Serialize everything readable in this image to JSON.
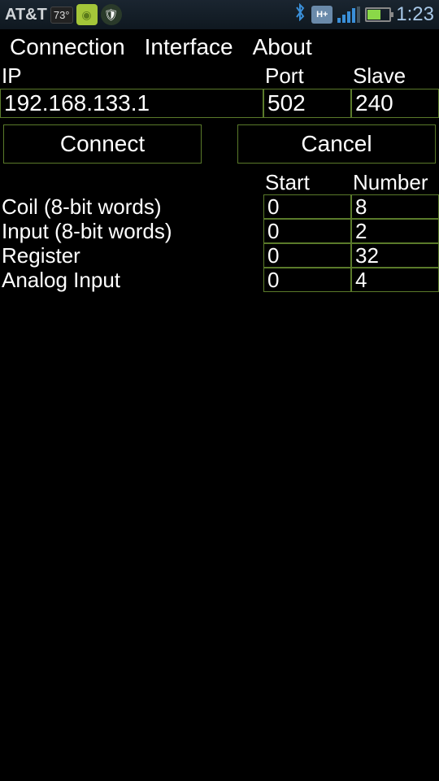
{
  "status": {
    "carrier": "AT&T",
    "temperature": "73°",
    "network_badge": "H+",
    "time": "1:23"
  },
  "tabs": {
    "connection": "Connection",
    "interface": "Interface",
    "about": "About"
  },
  "form": {
    "ip_label": "IP",
    "ip_value": "192.168.133.1",
    "port_label": "Port",
    "port_value": "502",
    "slave_label": "Slave",
    "slave_value": "240"
  },
  "buttons": {
    "connect": "Connect",
    "cancel": "Cancel"
  },
  "grid": {
    "header_start": "Start",
    "header_number": "Number",
    "rows": [
      {
        "label": "Coil (8-bit words)",
        "start": "0",
        "number": "8"
      },
      {
        "label": "Input (8-bit words)",
        "start": "0",
        "number": "2"
      },
      {
        "label": "Register",
        "start": "0",
        "number": "32"
      },
      {
        "label": "Analog Input",
        "start": "0",
        "number": "4"
      }
    ]
  }
}
